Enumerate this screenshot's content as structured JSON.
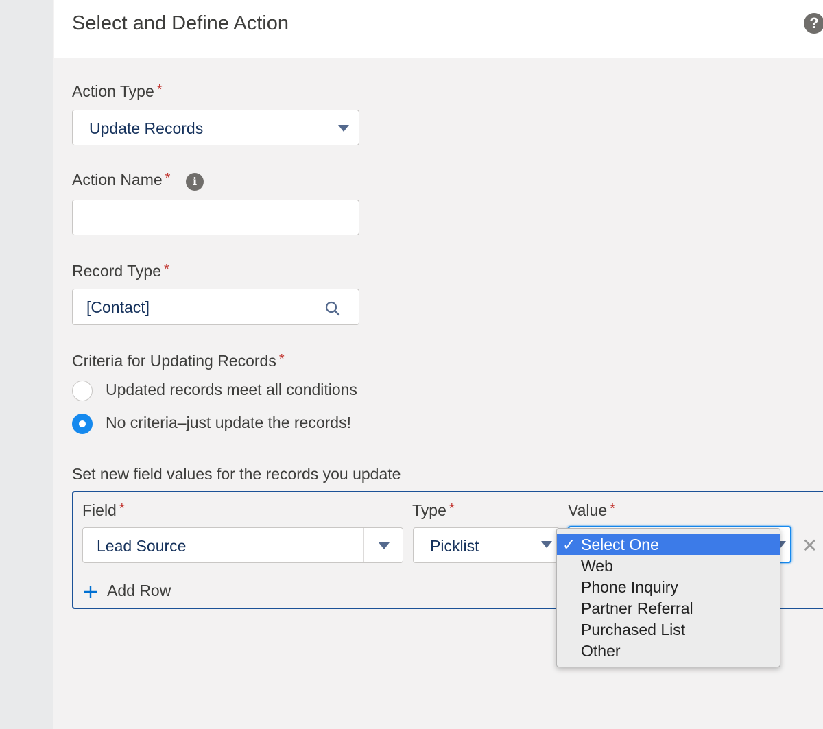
{
  "header": {
    "title": "Select and Define Action",
    "help_icon": "question-circle-icon"
  },
  "required_mark": "*",
  "action_type": {
    "label": "Action Type",
    "value": "Update Records"
  },
  "action_name": {
    "label": "Action Name",
    "value": "",
    "info_icon": "info-icon"
  },
  "record_type": {
    "label": "Record Type",
    "value": "[Contact]",
    "icon": "search-icon"
  },
  "criteria": {
    "label": "Criteria for Updating Records",
    "options": [
      {
        "label": "Updated records meet all conditions",
        "checked": false
      },
      {
        "label": "No criteria–just update the records!",
        "checked": true
      }
    ]
  },
  "field_values": {
    "label": "Set new field values for the records you update",
    "columns": {
      "field": "Field",
      "type": "Type",
      "value": "Value"
    },
    "row": {
      "field": "Lead Source",
      "type": "Picklist",
      "value": "Select One"
    },
    "add_row": "Add Row"
  },
  "value_dropdown": {
    "checkmark": "✓",
    "options": [
      "Select One",
      "Web",
      "Phone Inquiry",
      "Partner Referral",
      "Purchased List",
      "Other"
    ],
    "selected_index": 0
  },
  "colors": {
    "accent": "#1589ee",
    "required": "#c23934",
    "selection": "#3c7be8"
  }
}
